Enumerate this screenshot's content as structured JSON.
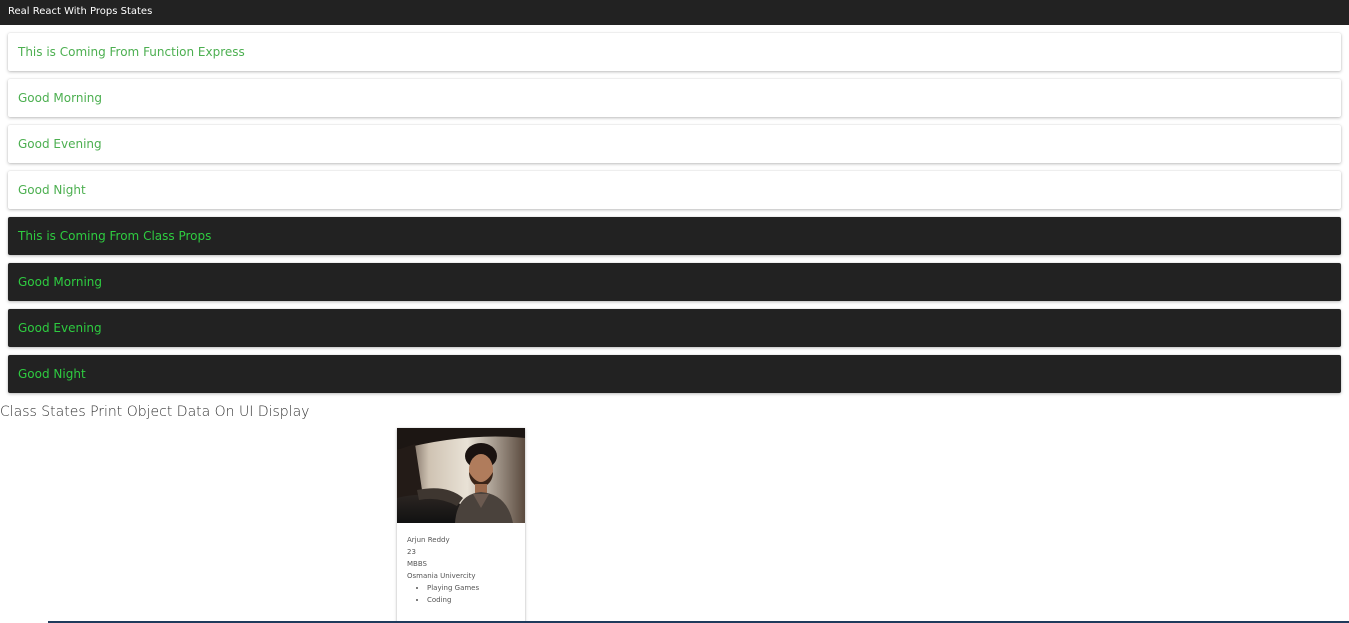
{
  "app": {
    "title": "Real React With Props States"
  },
  "function_panels": [
    {
      "text": "This is Coming From Function Express"
    },
    {
      "text": "Good Morning"
    },
    {
      "text": "Good Evening"
    },
    {
      "text": "Good Night"
    }
  ],
  "class_panels": [
    {
      "text": "This is Coming From Class Props"
    },
    {
      "text": "Good Morning"
    },
    {
      "text": "Good Evening"
    },
    {
      "text": "Good Night"
    }
  ],
  "states_section": {
    "title": "Class States Print Object Data On UI Display"
  },
  "profile": {
    "name": "Arjun Reddy",
    "age": "23",
    "degree": "MBBS",
    "university": "Osmania Univercity",
    "hobbies": [
      "Playing Games",
      "Coding"
    ]
  },
  "colors": {
    "topbar": "#222222",
    "accent_light": "#4caf50",
    "accent_dark": "#2ecc40"
  }
}
